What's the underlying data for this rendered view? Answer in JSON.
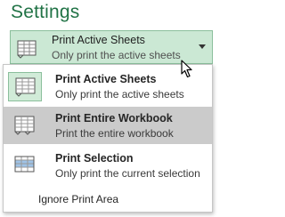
{
  "section_title": "Settings",
  "dropdown": {
    "title": "Print Active Sheets",
    "subtitle": "Only print the active sheets",
    "icon": "active-sheets-icon"
  },
  "menu": {
    "items": [
      {
        "title": "Print Active Sheets",
        "subtitle": "Only print the active sheets",
        "icon": "active-sheets-icon",
        "state": "selected"
      },
      {
        "title": "Print Entire Workbook",
        "subtitle": "Print the entire workbook",
        "icon": "entire-workbook-icon",
        "state": "hover"
      },
      {
        "title": "Print Selection",
        "subtitle": "Only print the current selection",
        "icon": "selection-icon",
        "state": "normal"
      }
    ],
    "ignore_print_area": "Ignore Print Area"
  },
  "colors": {
    "accent_green": "#217346",
    "selected_bg": "#cbe8d4",
    "hover_bg": "#cbcbcb",
    "selection_highlight": "#9fc3e7"
  }
}
